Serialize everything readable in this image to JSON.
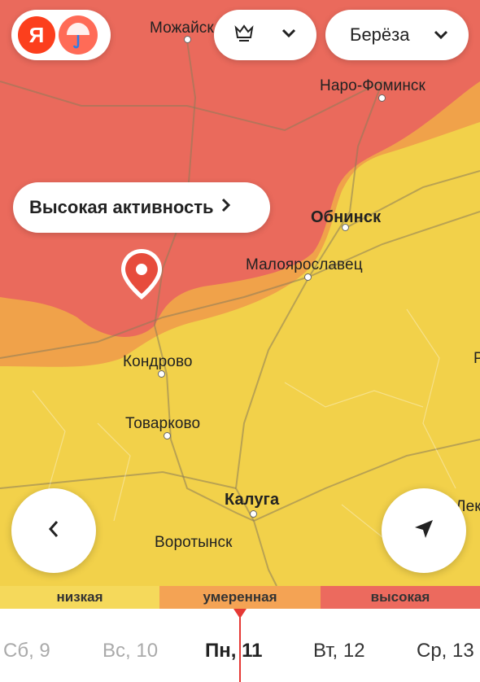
{
  "header": {
    "logo_letter": "Я",
    "species_label": "Берёза",
    "plant_icon": "flower-icon",
    "chevron_icon": "chevron-down-icon"
  },
  "activity": {
    "label": "Высокая активность",
    "chevron": "›"
  },
  "cities": {
    "mozhaysk": "Можайск",
    "naro_fominsk": "Наро-Фоминск",
    "obninsk": "Обнинск",
    "maloyaroslavets": "Малоярославец",
    "kondrovo": "Кондрово",
    "tovarkovo": "Товарково",
    "kaluga": "Калуга",
    "vorotynsk": "Воротынск",
    "cut_right_1": "Р",
    "cut_right_2": "Лек"
  },
  "legend": {
    "low": "низкая",
    "moderate": "умеренная",
    "high": "высокая"
  },
  "days": [
    {
      "label": "Сб, 9"
    },
    {
      "label": "Вс, 10"
    },
    {
      "label": "Пн, 11"
    },
    {
      "label": "Вт, 12"
    },
    {
      "label": "Ср, 13"
    }
  ],
  "colors": {
    "high": "#ec6a5e",
    "moderate": "#f4a354",
    "low": "#f5d95b",
    "accent": "#e53935",
    "yandex": "#fc3f1d"
  }
}
